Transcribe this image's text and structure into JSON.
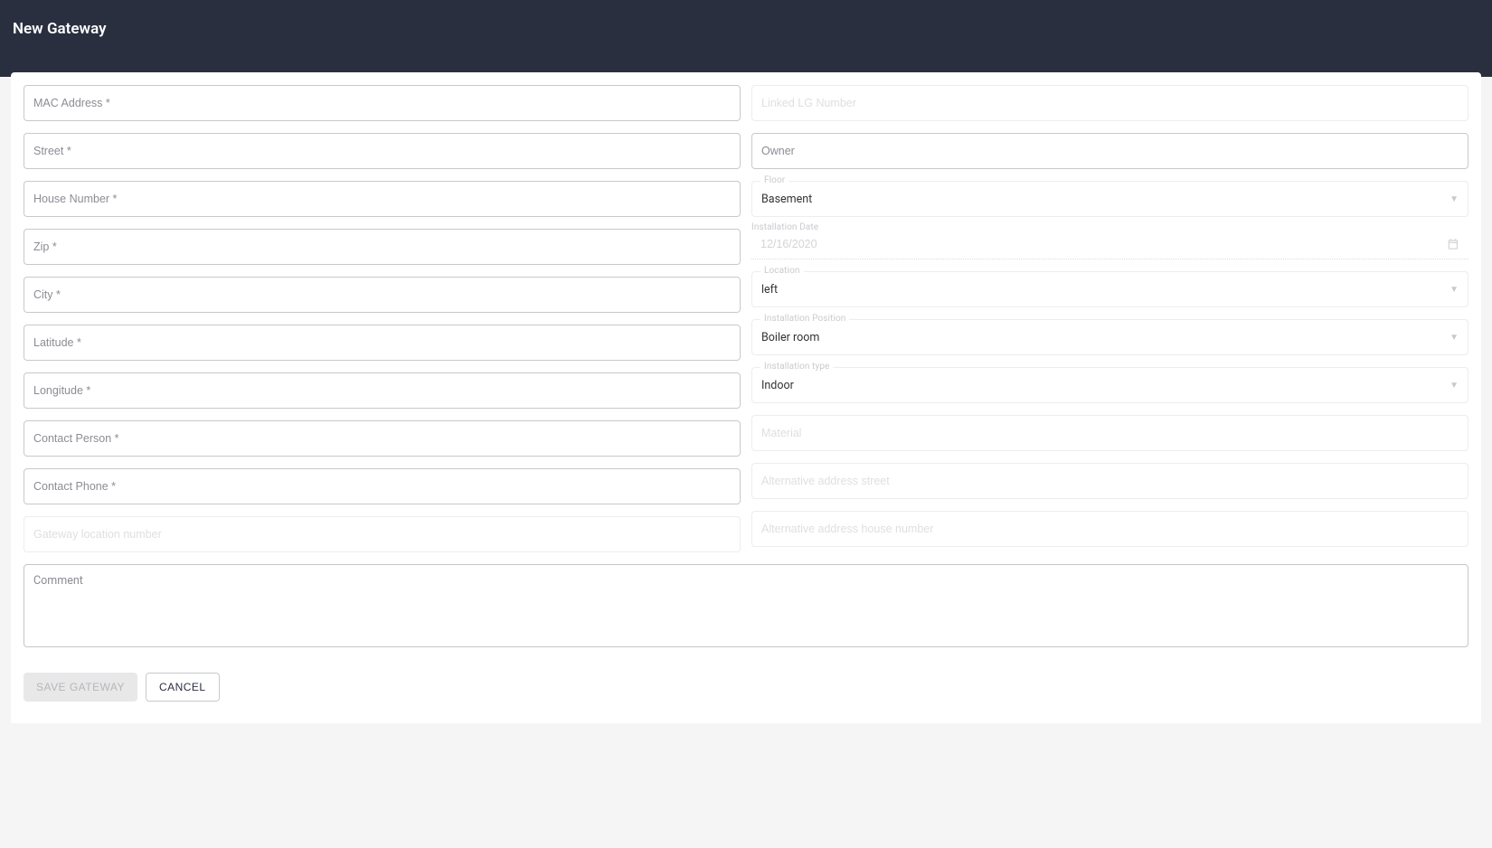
{
  "header": {
    "title": "New Gateway"
  },
  "left": {
    "mac": {
      "placeholder": "MAC Address *"
    },
    "street": {
      "placeholder": "Street *"
    },
    "house": {
      "placeholder": "House Number *"
    },
    "zip": {
      "placeholder": "Zip *"
    },
    "city": {
      "placeholder": "City *"
    },
    "lat": {
      "placeholder": "Latitude *"
    },
    "lon": {
      "placeholder": "Longitude *"
    },
    "contactPerson": {
      "placeholder": "Contact Person *"
    },
    "contactPhone": {
      "placeholder": "Contact Phone *"
    },
    "gatewayLoc": {
      "placeholder": "Gateway location number"
    }
  },
  "right": {
    "linkedLg": {
      "placeholder": "Linked LG Number"
    },
    "owner": {
      "placeholder": "Owner"
    },
    "floor": {
      "label": "Floor",
      "value": "Basement"
    },
    "installDate": {
      "label": "Installation Date",
      "value": "12/16/2020"
    },
    "location": {
      "label": "Location",
      "value": "left"
    },
    "installPos": {
      "label": "Installation Position",
      "value": "Boiler room"
    },
    "installType": {
      "label": "Installation type",
      "value": "Indoor"
    },
    "material": {
      "placeholder": "Material"
    },
    "altStreet": {
      "placeholder": "Alternative address street"
    },
    "altHouse": {
      "placeholder": "Alternative address house number"
    }
  },
  "comment": {
    "placeholder": "Comment"
  },
  "actions": {
    "save": "SAVE GATEWAY",
    "cancel": "CANCEL"
  }
}
